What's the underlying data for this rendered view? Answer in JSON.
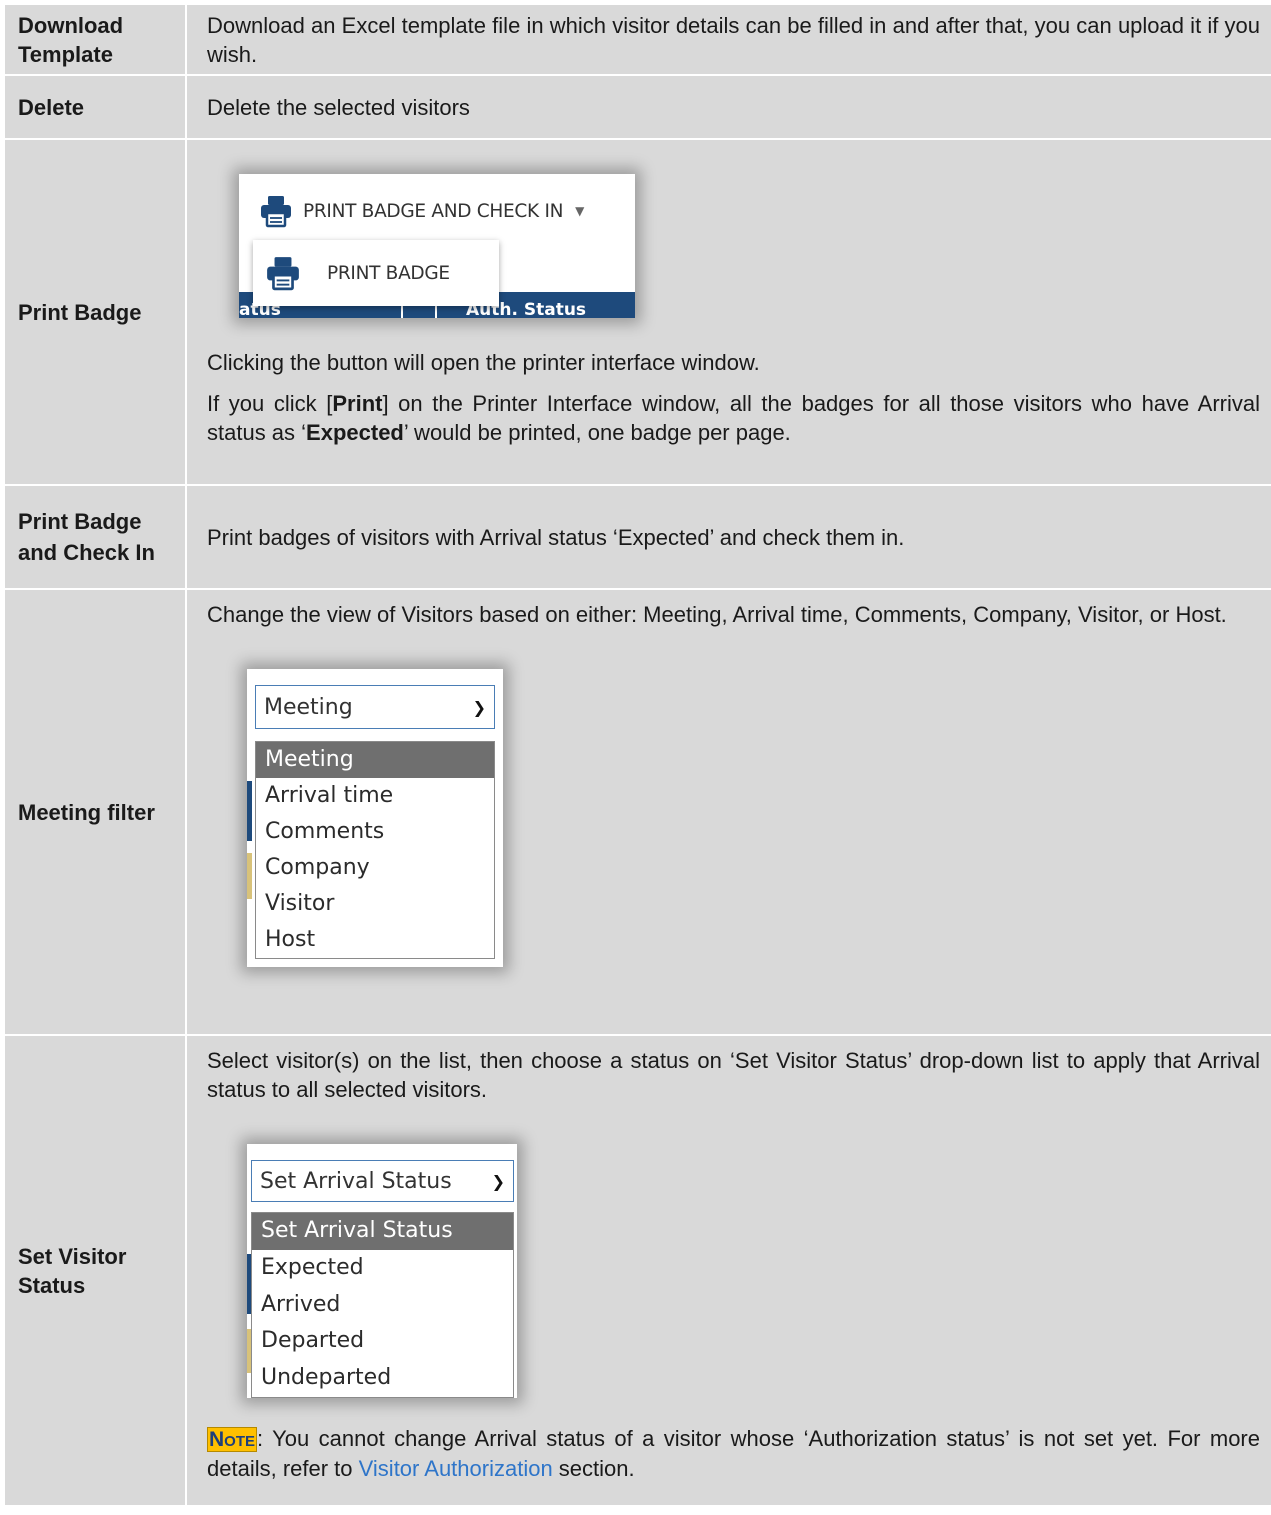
{
  "rows": {
    "download_template": {
      "term": "Download Template",
      "desc": "Download an Excel template file in which visitor details can be filled in and after that, you can upload it if you wish."
    },
    "delete": {
      "term": "Delete",
      "desc": "Delete the selected visitors"
    },
    "print_badge": {
      "term": "Print Badge",
      "screenshot": {
        "button_label": "PRINT BADGE AND CHECK IN",
        "menu_item_label": "PRINT BADGE",
        "header_col1": "atus",
        "header_col2": "Auth. Status"
      },
      "para1": "Clicking the button will open the printer interface window.",
      "para2_pre": "If you click [",
      "para2_bold1": "Print",
      "para2_mid": "] on the Printer Interface window, all the badges for all those visitors who have Arrival status as ‘",
      "para2_bold2": "Expected",
      "para2_post": "’ would be printed, one badge per page."
    },
    "print_badge_check_in": {
      "term": "Print Badge and Check In",
      "desc": "Print badges of visitors with Arrival status ‘Expected’ and check them in."
    },
    "meeting_filter": {
      "term": "Meeting filter",
      "desc": "Change the view of Visitors based on either: Meeting, Arrival time, Comments, Company, Visitor, or Host.",
      "dropdown": {
        "selected": "Meeting",
        "options": [
          "Meeting",
          "Arrival time",
          "Comments",
          "Company",
          "Visitor",
          "Host"
        ]
      }
    },
    "set_visitor_status": {
      "term": "Set Visitor Status",
      "desc": "Select visitor(s) on the list, then choose a status on ‘Set Visitor Status’ drop-down list to apply that Arrival status to all selected visitors.",
      "dropdown": {
        "selected": "Set Arrival Status",
        "options": [
          "Set Arrival Status",
          "Expected",
          "Arrived",
          "Departed",
          "Undeparted"
        ]
      },
      "note_label": "Note",
      "note_pre": ": You cannot change Arrival status of a visitor whose ‘Authorization status’ is not set yet. For more details, refer to ",
      "note_link": "Visitor Authorization",
      "note_post": " section."
    }
  },
  "colors": {
    "table_bg": "#d9d9d9",
    "header_band": "#1e4a7c",
    "accent_gold": "#d8c27a",
    "note_tag_bg": "#ffc000",
    "link": "#2e75c9"
  },
  "icons": [
    "printer-icon",
    "chevron-down-icon",
    "caret-down-icon"
  ]
}
